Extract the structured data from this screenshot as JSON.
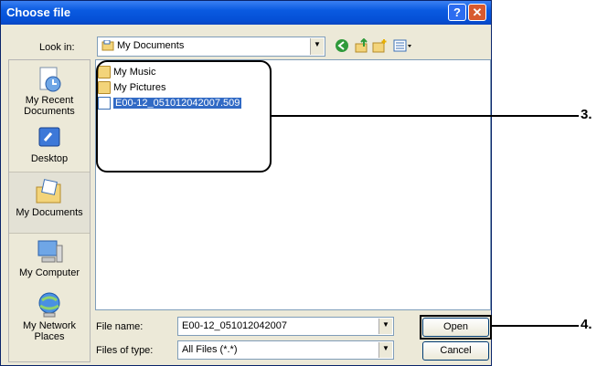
{
  "window": {
    "title": "Choose file",
    "help_label": "?",
    "close_label": "✕"
  },
  "lookin": {
    "label": "Look in:",
    "value": "My Documents"
  },
  "places": [
    {
      "label": "My Recent Documents",
      "icon": "recent-documents-icon"
    },
    {
      "label": "Desktop",
      "icon": "desktop-icon"
    },
    {
      "label": "My Documents",
      "icon": "my-documents-icon",
      "selected": true
    },
    {
      "label": "My Computer",
      "icon": "my-computer-icon"
    },
    {
      "label": "My Network Places",
      "icon": "network-places-icon"
    }
  ],
  "files": [
    {
      "name": "My Music",
      "type": "folder"
    },
    {
      "name": "My Pictures",
      "type": "folder"
    },
    {
      "name": "E00-12_051012042007.509",
      "type": "file",
      "selected": true
    }
  ],
  "filename": {
    "label": "File name:",
    "value": "E00-12_051012042007"
  },
  "filetype": {
    "label": "Files of type:",
    "value": "All Files (*.*)"
  },
  "buttons": {
    "open": "Open",
    "cancel": "Cancel"
  },
  "callouts": {
    "list": "3.",
    "open": "4."
  },
  "colors": {
    "titlebar": "#0a5ae0",
    "selection": "#316ac5",
    "dialog_bg": "#ece9d8"
  }
}
